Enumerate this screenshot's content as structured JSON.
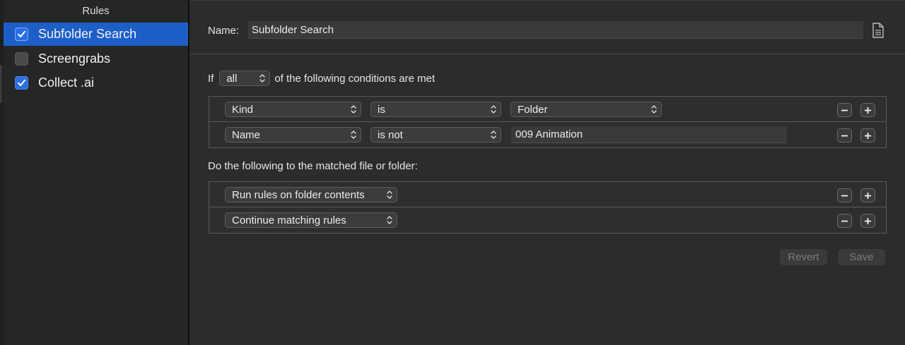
{
  "sidebar": {
    "header": "Rules",
    "items": [
      {
        "label": "Subfolder Search",
        "checked": true,
        "selected": true
      },
      {
        "label": "Screengrabs",
        "checked": false,
        "selected": false
      },
      {
        "label": "Collect .ai",
        "checked": true,
        "selected": false
      }
    ]
  },
  "editor": {
    "name_label": "Name:",
    "name_value": "Subfolder Search",
    "conditions_prefix": "If",
    "match_mode": "all",
    "conditions_suffix": "of the following conditions are met",
    "conditions": [
      {
        "attribute": "Kind",
        "operator": "is",
        "value": "Folder",
        "value_type": "popup"
      },
      {
        "attribute": "Name",
        "operator": "is not",
        "value": "009 Animation",
        "value_type": "text"
      }
    ],
    "actions_label": "Do the following to the matched file or folder:",
    "actions": [
      {
        "action": "Run rules on folder contents"
      },
      {
        "action": "Continue matching rules"
      }
    ],
    "revert_label": "Revert",
    "save_label": "Save"
  },
  "colors": {
    "selection": "#1d5fc9",
    "checkbox_checked": "#2c6fe0",
    "background": "#2b2b2b"
  },
  "icons": [
    "checkmark-icon",
    "document-icon",
    "chevron-updown-icon",
    "minus-icon",
    "plus-icon"
  ]
}
